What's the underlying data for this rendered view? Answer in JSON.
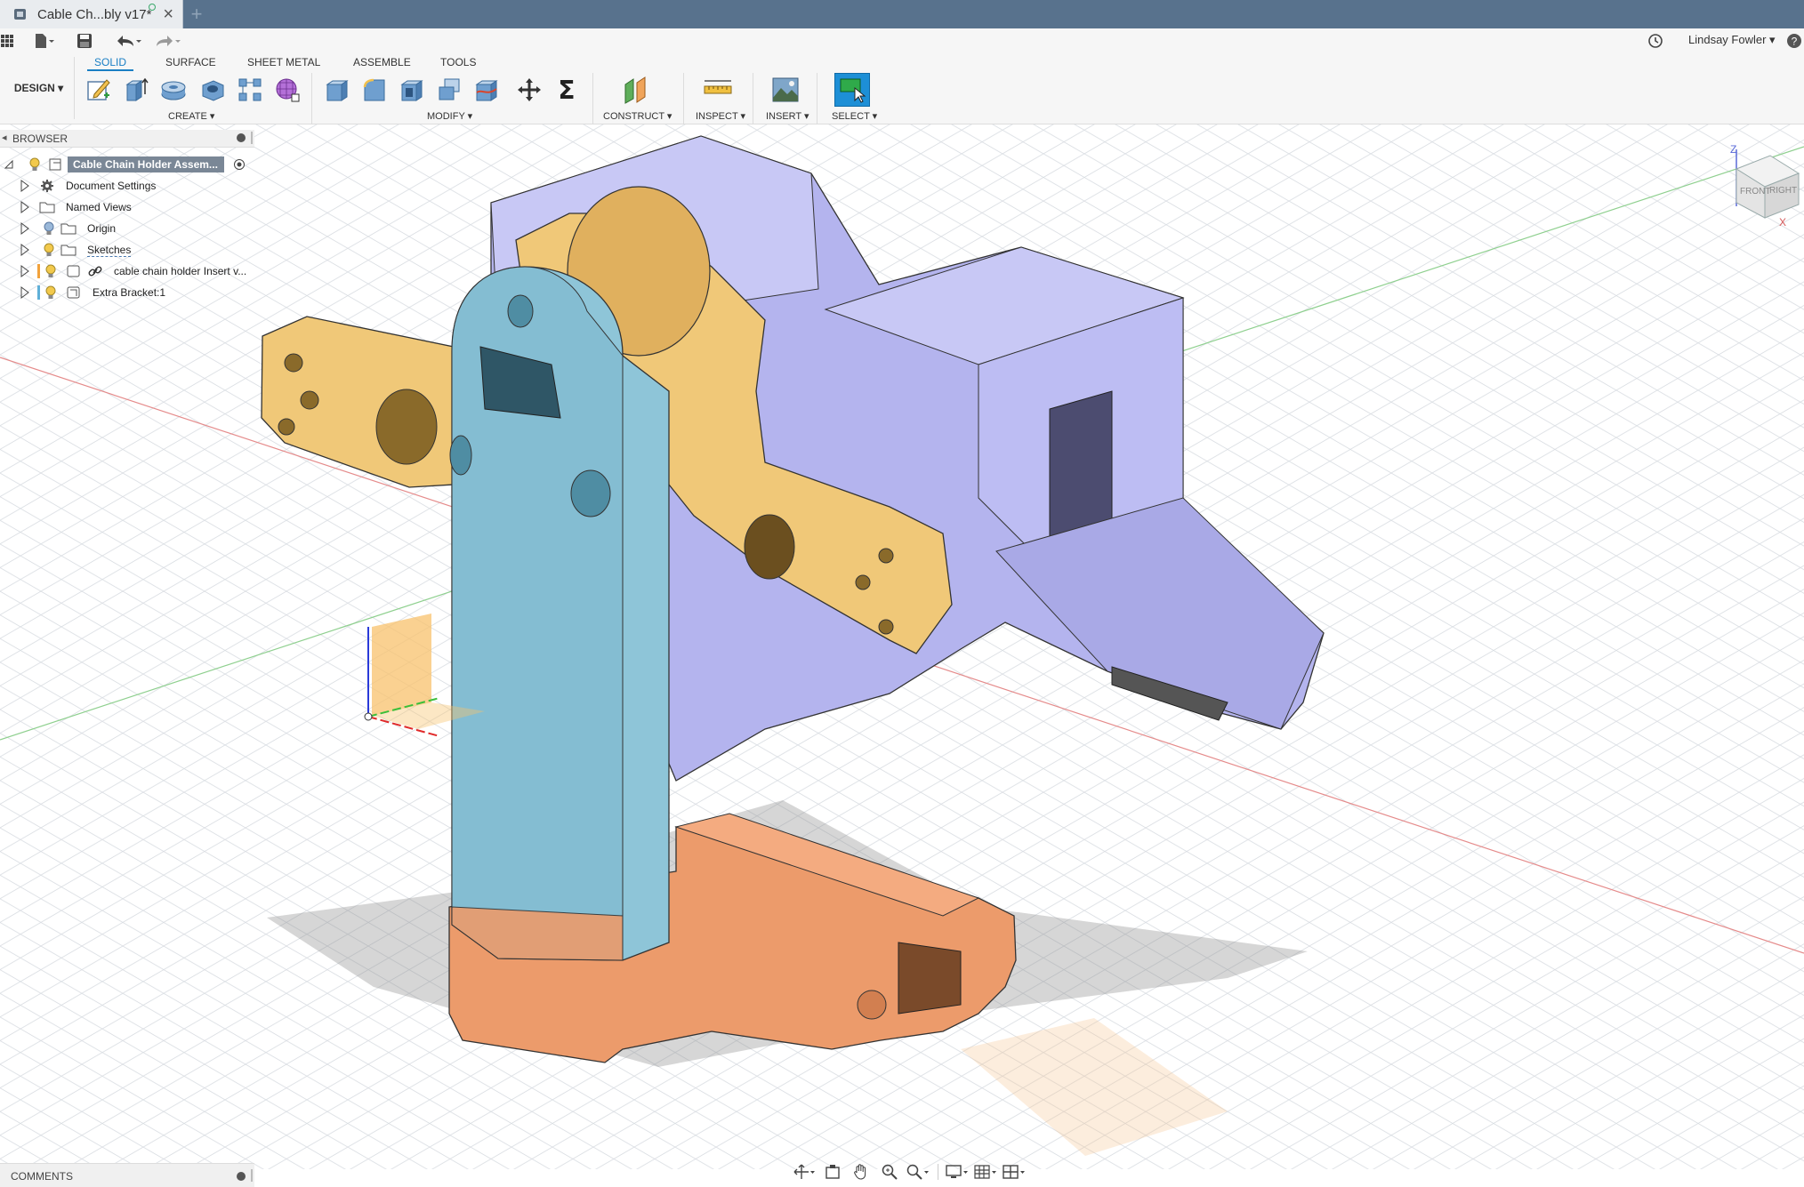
{
  "window": {
    "tab_title": "Cable Ch...bly v17*",
    "close_glyph": "×",
    "new_tab_glyph": "+"
  },
  "quick_access": {
    "user_name": "Lindsay Fowler ▾",
    "help_glyph": "?"
  },
  "ribbon": {
    "workspace": "DESIGN ▾",
    "tabs": [
      "SOLID",
      "SURFACE",
      "SHEET METAL",
      "ASSEMBLE",
      "TOOLS"
    ],
    "active_tab": "SOLID",
    "groups": {
      "create": "CREATE ▾",
      "modify": "MODIFY ▾",
      "construct": "CONSTRUCT ▾",
      "inspect": "INSPECT ▾",
      "insert": "INSERT ▾",
      "select": "SELECT ▾"
    },
    "sigma_glyph": "Σ"
  },
  "browser": {
    "header": "BROWSER",
    "root": "Cable Chain Holder Assem...",
    "items": [
      {
        "label": "Document Settings",
        "icon": "gear-icon"
      },
      {
        "label": "Named Views",
        "icon": "folder-icon"
      },
      {
        "label": "Origin",
        "icon": "folder-icon"
      },
      {
        "label": "Sketches",
        "icon": "folder-icon"
      },
      {
        "label": "cable chain holder Insert v...",
        "icon": "link-icon"
      },
      {
        "label": "Extra Bracket:1",
        "icon": "component-icon"
      }
    ]
  },
  "viewcube": {
    "front": "FRONT",
    "right": "RIGHT",
    "z": "Z",
    "x": "X"
  },
  "comments": {
    "label": "COMMENTS"
  },
  "colors": {
    "title_bar": "#58728d",
    "accent": "#1a7fc4",
    "purple_body": "#b4b4ee",
    "blue_body": "#8ec5d8",
    "yellow_body": "#f0c878",
    "orange_body": "#ec9b6b"
  }
}
